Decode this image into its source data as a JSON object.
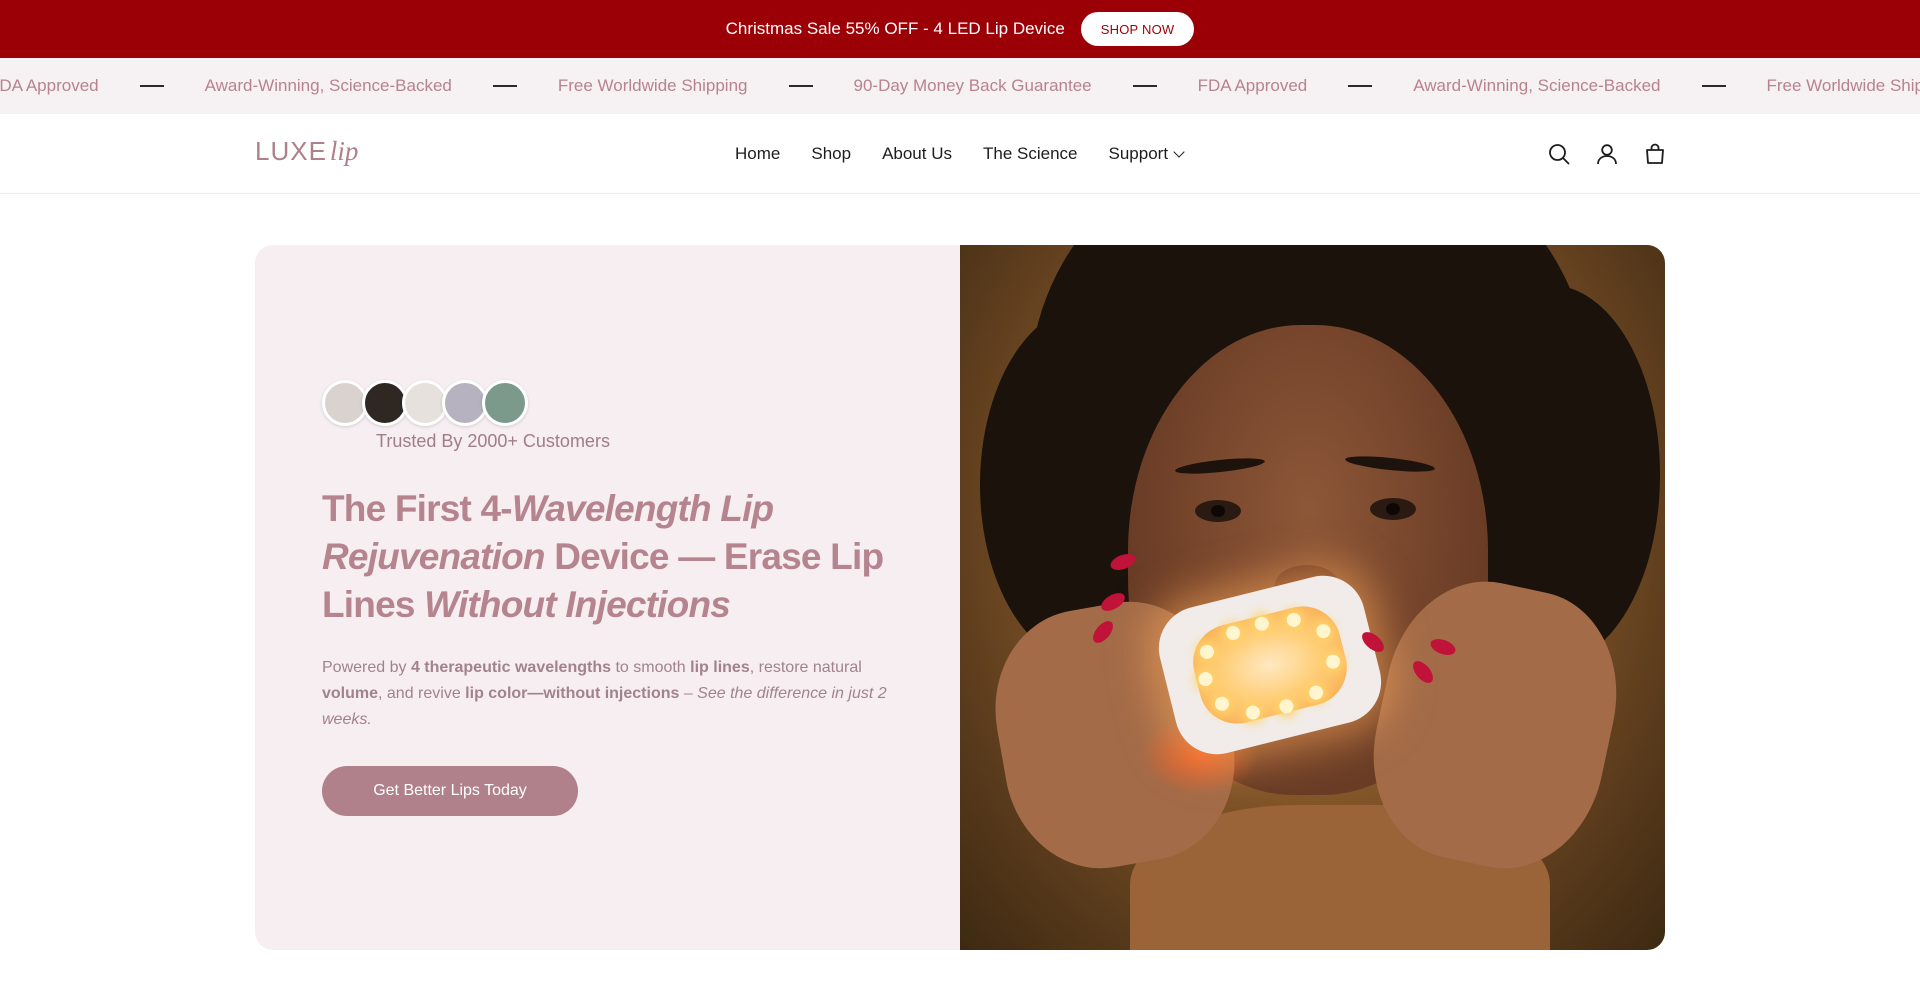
{
  "announcement": {
    "text": "Christmas Sale 55% OFF - 4 LED Lip Device",
    "button_label": "SHOP NOW"
  },
  "marquee": {
    "items": [
      "FDA Approved",
      "Award-Winning, Science-Backed",
      "Free Worldwide Shipping",
      "90-Day Money Back Guarantee",
      "FDA Approved",
      "Award-Winning, Science-Backed",
      "Free Worldwide Shipping"
    ]
  },
  "header": {
    "logo_main": "LUXE",
    "logo_sub": "lip",
    "nav": [
      "Home",
      "Shop",
      "About Us",
      "The Science",
      "Support"
    ]
  },
  "hero": {
    "trusted_text": "Trusted By 2000+ Customers",
    "headline": {
      "part1": "The First 4-",
      "part2_italic": "Wavelength Lip Rejuvenation",
      "part3": " Device — Erase Lip Lines ",
      "part4_italic": "Without Injections"
    },
    "description": {
      "t1": "Powered by ",
      "b1": "4 therapeutic wavelengths",
      "t2": " to smooth ",
      "b2": "lip lines",
      "t3": ", restore natural ",
      "b3": "volume",
      "t4": ", and revive ",
      "b4": "lip color—without injections",
      "i1": " – See the difference in just 2 weeks."
    },
    "cta_label": "Get Better Lips Today",
    "avatar_colors": [
      "#d9d2cf",
      "#2e2722",
      "#e6e1dc",
      "#b7b2c0",
      "#7c9a8c"
    ]
  },
  "colors": {
    "announcement_bg": "#9b0006",
    "brand_rose": "#b0808b",
    "hero_bg": "#f6eef1"
  }
}
